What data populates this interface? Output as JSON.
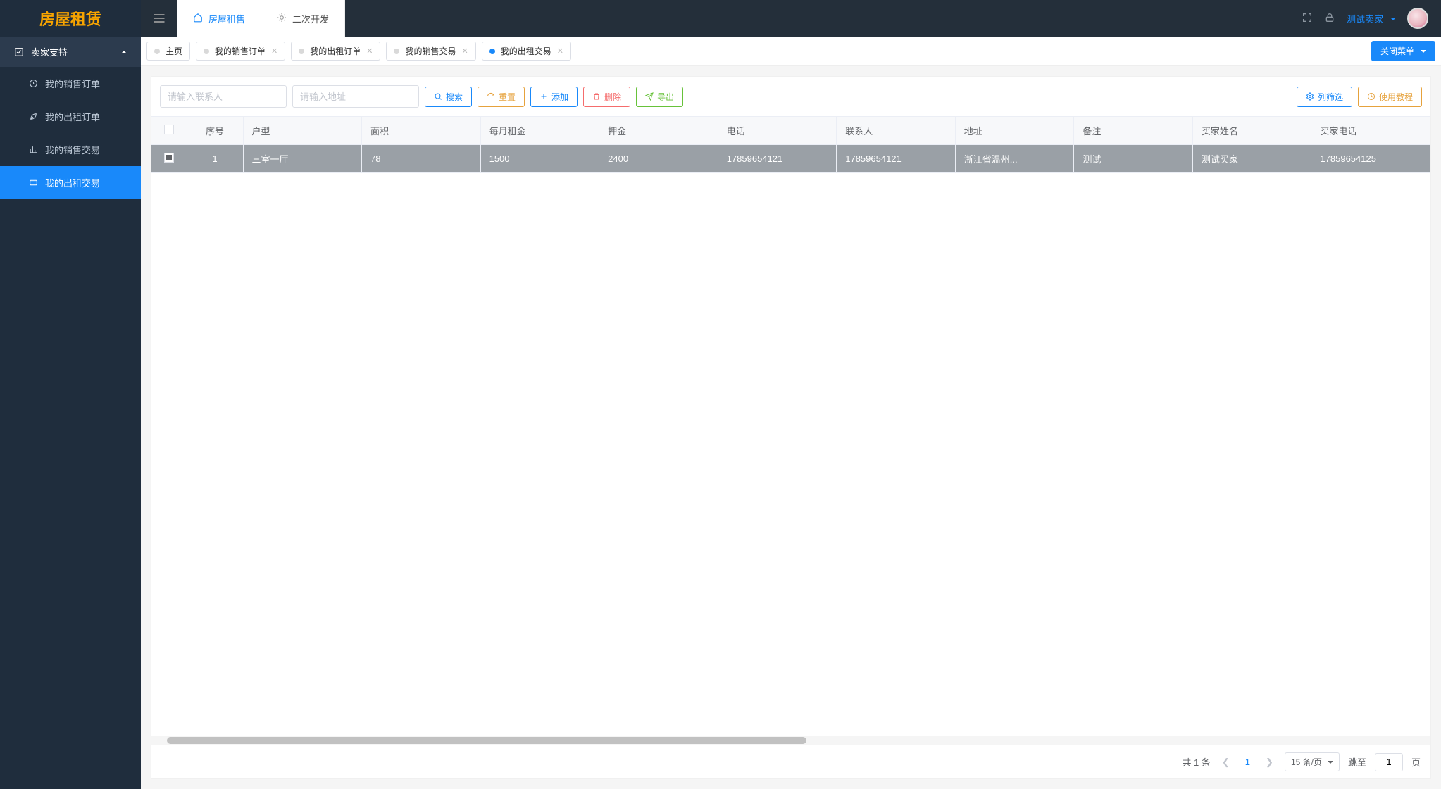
{
  "brand": "房屋租赁",
  "top_tabs": [
    {
      "label": "房屋租售",
      "icon": "home"
    },
    {
      "label": "二次开发",
      "icon": "sun"
    }
  ],
  "active_top_tab": 0,
  "user": {
    "name": "测试卖家"
  },
  "close_menu_label": "关闭菜单",
  "sidebar": {
    "group": "卖家支持",
    "items": [
      {
        "label": "我的销售订单",
        "icon": "clock"
      },
      {
        "label": "我的出租订单",
        "icon": "leaf"
      },
      {
        "label": "我的销售交易",
        "icon": "chart"
      },
      {
        "label": "我的出租交易",
        "icon": "card"
      }
    ],
    "active": 3
  },
  "page_tabs": [
    {
      "label": "主页",
      "closable": false
    },
    {
      "label": "我的销售订单",
      "closable": true
    },
    {
      "label": "我的出租订单",
      "closable": true
    },
    {
      "label": "我的销售交易",
      "closable": true
    },
    {
      "label": "我的出租交易",
      "closable": true
    }
  ],
  "active_page_tab": 4,
  "search": {
    "contact_placeholder": "请输入联系人",
    "address_placeholder": "请输入地址"
  },
  "buttons": {
    "search": "搜索",
    "reset": "重置",
    "add": "添加",
    "delete": "删除",
    "export": "导出",
    "column_filter": "列筛选",
    "tutorial": "使用教程"
  },
  "table": {
    "columns": [
      "序号",
      "户型",
      "面积",
      "每月租金",
      "押金",
      "电话",
      "联系人",
      "地址",
      "备注",
      "买家姓名",
      "买家电话"
    ],
    "rows": [
      {
        "selected": true,
        "序号": "1",
        "户型": "三室一厅",
        "面积": "78",
        "每月租金": "1500",
        "押金": "2400",
        "电话": "17859654121",
        "联系人": "17859654121",
        "地址": "浙江省温州...",
        "备注": "测试",
        "买家姓名": "测试买家",
        "买家电话": "17859654125"
      }
    ]
  },
  "pagination": {
    "total_text": "共 1 条",
    "page": "1",
    "page_size_label": "15 条/页",
    "jump_label": "跳至",
    "jump_value": "1",
    "page_suffix": "页"
  }
}
